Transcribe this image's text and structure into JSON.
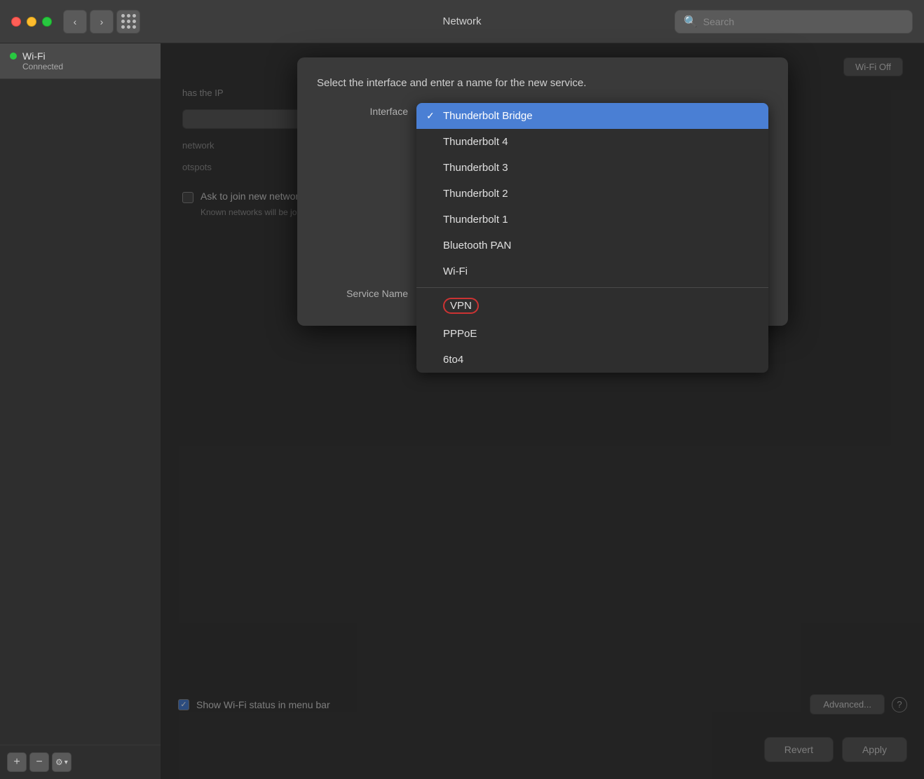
{
  "titleBar": {
    "title": "Network",
    "searchPlaceholder": "Search"
  },
  "sidebar": {
    "items": [
      {
        "name": "Wi-Fi",
        "status": "Connected",
        "connected": true
      }
    ],
    "addLabel": "+",
    "removeLabel": "−",
    "gearLabel": "⚙"
  },
  "dialog": {
    "title": "Select the interface and enter a name for the new service.",
    "interfaceLabel": "Interface",
    "serviceNameLabel": "Service Name",
    "selectedInterface": "Thunderbolt Bridge",
    "dropdownItems": [
      {
        "label": "Thunderbolt Bridge",
        "selected": true
      },
      {
        "label": "Thunderbolt 4",
        "selected": false
      },
      {
        "label": "Thunderbolt 3",
        "selected": false
      },
      {
        "label": "Thunderbolt 2",
        "selected": false
      },
      {
        "label": "Thunderbolt 1",
        "selected": false
      },
      {
        "label": "Bluetooth PAN",
        "selected": false
      },
      {
        "label": "Wi-Fi",
        "selected": false
      }
    ],
    "dropdownDivider": true,
    "dropdownItemsBelow": [
      {
        "label": "VPN",
        "isVPN": true
      },
      {
        "label": "PPPoE"
      },
      {
        "label": "6to4"
      }
    ]
  },
  "panel": {
    "wifiOffLabel": "Wi-Fi Off",
    "hasIPLabel": "has the IP",
    "networkLabel": "network",
    "hotspotsLabel": "otspots",
    "askToJoinLabel": "Ask to join new networks",
    "askToJoinDesc": "Known networks will be joined automatically. If no known networks are available, you will have to manually select a network.",
    "showWifiLabel": "Show Wi-Fi status in menu bar",
    "advancedLabel": "Advanced...",
    "helpLabel": "?",
    "revertLabel": "Revert",
    "applyLabel": "Apply"
  }
}
